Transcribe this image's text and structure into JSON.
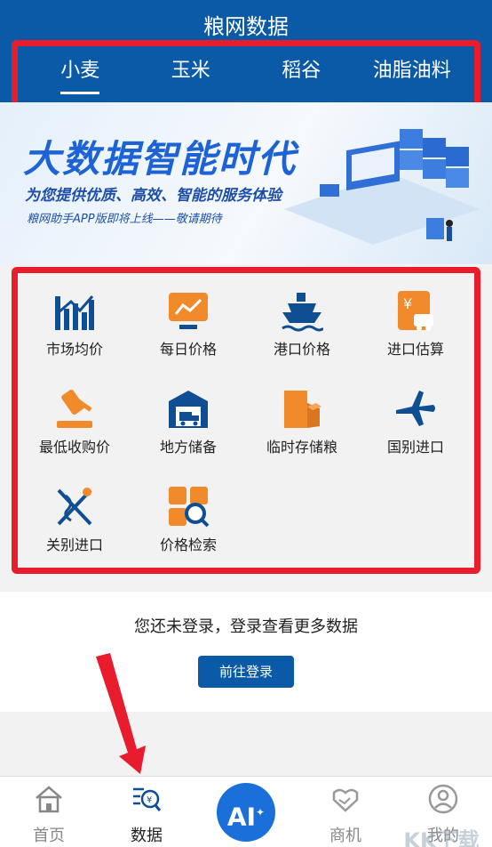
{
  "header": {
    "title": "粮网数据"
  },
  "tabs": [
    {
      "label": "小麦",
      "active": true
    },
    {
      "label": "玉米",
      "active": false
    },
    {
      "label": "稻谷",
      "active": false
    },
    {
      "label": "油脂油料",
      "active": false
    }
  ],
  "banner": {
    "headline": "大数据智能时代",
    "subtitle": "为您提供优质、高效、智能的服务体验",
    "note": "粮网助手APP版即将上线——敬请期待"
  },
  "grid": [
    {
      "label": "市场均价",
      "icon": "bar-chart-icon"
    },
    {
      "label": "每日价格",
      "icon": "line-chart-monitor-icon"
    },
    {
      "label": "港口价格",
      "icon": "ship-icon"
    },
    {
      "label": "进口估算",
      "icon": "import-calculator-icon"
    },
    {
      "label": "最低收购价",
      "icon": "gavel-icon"
    },
    {
      "label": "地方储备",
      "icon": "warehouse-truck-icon"
    },
    {
      "label": "临时存储粮",
      "icon": "storage-box-icon"
    },
    {
      "label": "国别进口",
      "icon": "airplane-icon"
    },
    {
      "label": "关别进口",
      "icon": "customs-caduceus-icon"
    },
    {
      "label": "价格检索",
      "icon": "price-search-icon"
    }
  ],
  "login": {
    "prompt": "您还未登录，登录查看更多数据",
    "button": "前往登录"
  },
  "tabbar": [
    {
      "label": "首页",
      "icon": "home-icon",
      "active": false
    },
    {
      "label": "数据",
      "icon": "data-search-icon",
      "active": true
    },
    {
      "label": "AI",
      "icon": "ai-sparkle-icon",
      "active": false
    },
    {
      "label": "商机",
      "icon": "handshake-icon",
      "active": false
    },
    {
      "label": "我的",
      "icon": "user-icon",
      "active": false
    }
  ],
  "watermark": {
    "text": "KK下载"
  },
  "colors": {
    "primary": "#0a5aa8",
    "icon_blue": "#0f4e93",
    "icon_orange": "#f08a2a",
    "highlight": "#e81c2c"
  }
}
